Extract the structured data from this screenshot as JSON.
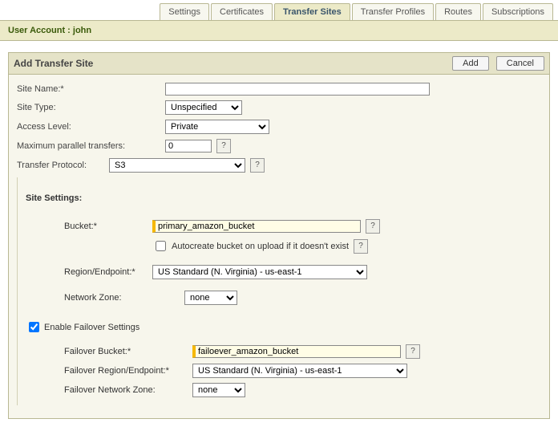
{
  "tabs": {
    "settings": "Settings",
    "certificates": "Certificates",
    "transfer_sites": "Transfer Sites",
    "transfer_profiles": "Transfer Profiles",
    "routes": "Routes",
    "subscriptions": "Subscriptions"
  },
  "user_account_label": "User Account : john",
  "panel": {
    "title": "Add Transfer Site",
    "add_btn": "Add",
    "cancel_btn": "Cancel"
  },
  "form": {
    "site_name_label": "Site Name:*",
    "site_name_value": "",
    "site_type_label": "Site Type:",
    "site_type_value": "Unspecified",
    "access_level_label": "Access Level:",
    "access_level_value": "Private",
    "max_parallel_label": "Maximum parallel transfers:",
    "max_parallel_value": "0",
    "transfer_protocol_label": "Transfer Protocol:",
    "transfer_protocol_value": "S3",
    "help": "?"
  },
  "site_settings": {
    "heading": "Site Settings:",
    "bucket_label": "Bucket:*",
    "bucket_value": "primary_amazon_bucket",
    "autocreate_label": "Autocreate bucket on upload if it doesn't exist",
    "region_label": "Region/Endpoint:*",
    "region_value": "US Standard (N. Virginia) - us-east-1",
    "zone_label": "Network Zone:",
    "zone_value": "none",
    "enable_failover_label": "Enable Failover Settings",
    "failover_bucket_label": "Failover Bucket:*",
    "failover_bucket_value": "failoever_amazon_bucket",
    "failover_region_label": "Failover Region/Endpoint:*",
    "failover_region_value": "US Standard (N. Virginia) - us-east-1",
    "failover_zone_label": "Failover Network Zone:",
    "failover_zone_value": "none"
  }
}
